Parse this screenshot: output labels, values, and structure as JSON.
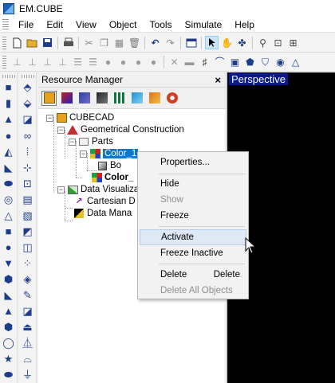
{
  "window": {
    "title": "EM.CUBE",
    "icon": "app-icon"
  },
  "menubar": {
    "items": [
      "File",
      "Edit",
      "View",
      "Object",
      "Tools",
      "Simulate",
      "Help"
    ]
  },
  "toolbar1": {
    "buttons": [
      "new-icon",
      "open-icon",
      "save-icon",
      "print-icon",
      "cut-icon",
      "copy-icon",
      "paste-icon",
      "delete-icon",
      "undo-icon",
      "redo-icon",
      "window-icon",
      "select-arrow-icon",
      "hand-pan-icon",
      "rotate-icon",
      "zoom-icon",
      "zoom-box-icon",
      "zoom-fit-icon"
    ]
  },
  "toolbar2": {
    "buttons": [
      "ruler-icon",
      "ruler-icon",
      "ruler-icon",
      "ruler-icon",
      "grid-icon",
      "grid-icon",
      "circle-icon",
      "circle-icon",
      "circle-icon",
      "circle-icon",
      "cross-icon",
      "layer-icon",
      "lattice-icon",
      "arc-icon",
      "object-icon",
      "shape-icon",
      "shield-icon",
      "eye-icon",
      "triangle-icon"
    ]
  },
  "resource_manager": {
    "title": "Resource Manager",
    "close_label": "×",
    "tabs": [
      "cad-tab-icon",
      "color-tab-icon",
      "material-tab-icon",
      "sheet-tab-icon",
      "mesh-tab-icon",
      "source-tab-icon",
      "observable-tab-icon",
      "network-tab-icon"
    ],
    "tree": {
      "root": "CUBECAD",
      "geometrical_construction": "Geometrical Construction",
      "parts": "Parts",
      "color_1": "Color_1",
      "box": "Bo",
      "color_2": "Color_",
      "data_visualization": "Data Visualizat",
      "cartesian": "Cartesian D",
      "data_manager": "Data Mana"
    }
  },
  "viewport": {
    "label": "Perspective"
  },
  "context_menu": {
    "items": [
      {
        "label": "Properties...",
        "shortcut": "",
        "enabled": true
      },
      {
        "label": "Hide",
        "shortcut": "",
        "enabled": true
      },
      {
        "label": "Show",
        "shortcut": "",
        "enabled": false
      },
      {
        "label": "Freeze",
        "shortcut": "",
        "enabled": true
      },
      {
        "label": "Activate",
        "shortcut": "",
        "enabled": true,
        "hovered": true
      },
      {
        "label": "Freeze Inactive",
        "shortcut": "",
        "enabled": true
      },
      {
        "label": "Delete",
        "shortcut": "Delete",
        "enabled": true
      },
      {
        "label": "Delete All Objects",
        "shortcut": "",
        "enabled": false
      }
    ]
  },
  "colors": {
    "selection": "#0078d7",
    "viewport_bg": "#000000",
    "view_label_bg": "#0a1a8a",
    "menu_hover": "#dfe8f5"
  }
}
